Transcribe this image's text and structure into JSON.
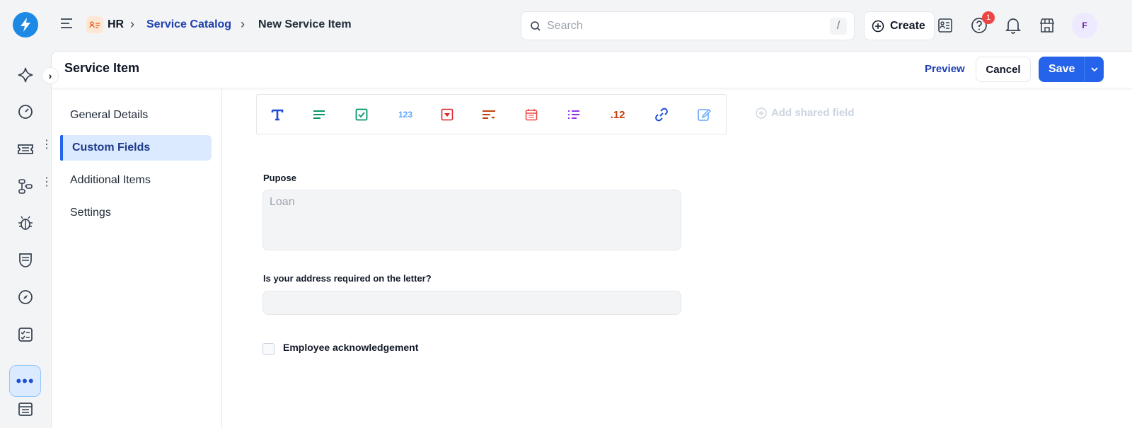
{
  "topbar": {
    "breadcrumb": [
      "HR",
      "Service Catalog",
      "New Service Item"
    ],
    "search_placeholder": "Search",
    "search_shortcut": "/",
    "create_label": "Create",
    "help_badge": "1",
    "avatar_initial": "F"
  },
  "card": {
    "title": "Service Item",
    "preview_label": "Preview",
    "cancel_label": "Cancel",
    "save_label": "Save"
  },
  "nav": {
    "items": [
      "General Details",
      "Custom Fields",
      "Additional Items",
      "Settings"
    ],
    "active": "Custom Fields"
  },
  "toolbar": {
    "tools": [
      "text-icon",
      "paragraph-icon",
      "checkbox-icon",
      "number-icon",
      "dropdown-icon",
      "multi-select-icon",
      "date-icon",
      "list-icon",
      "decimal-icon",
      "link-icon",
      "edit-icon"
    ],
    "number_glyph": "123",
    "decimal_glyph": ".12",
    "add_shared_label": "Add shared field"
  },
  "form": {
    "purpose_label": "Pupose",
    "purpose_placeholder": "Loan",
    "address_label": "Is your address required on the letter?",
    "ack_label": "Employee acknowledgement"
  },
  "colors": {
    "accent": "#2563eb",
    "link": "#1e40af",
    "active_nav_bg": "#dbeafe",
    "badge": "#ef4444"
  }
}
